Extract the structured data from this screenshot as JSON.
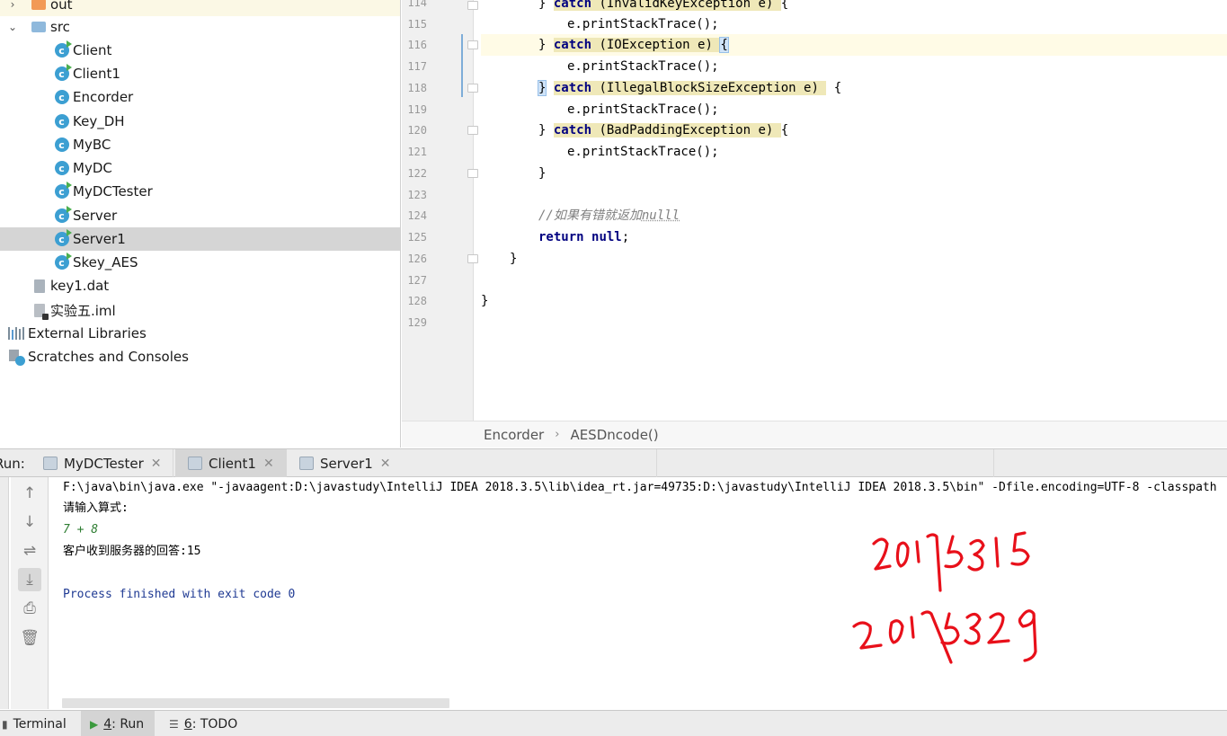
{
  "project_tree": {
    "items": [
      {
        "label": "out",
        "kind": "folder-out"
      },
      {
        "label": "src",
        "kind": "folder-src"
      },
      {
        "label": "Client",
        "kind": "class-run"
      },
      {
        "label": "Client1",
        "kind": "class-run"
      },
      {
        "label": "Encorder",
        "kind": "class"
      },
      {
        "label": "Key_DH",
        "kind": "class"
      },
      {
        "label": "MyBC",
        "kind": "class"
      },
      {
        "label": "MyDC",
        "kind": "class"
      },
      {
        "label": "MyDCTester",
        "kind": "class-run"
      },
      {
        "label": "Server",
        "kind": "class-run"
      },
      {
        "label": "Server1",
        "kind": "class-run"
      },
      {
        "label": "Skey_AES",
        "kind": "class-run"
      },
      {
        "label": "key1.dat",
        "kind": "unknown-file"
      },
      {
        "label": "实验五.iml",
        "kind": "iml-file"
      },
      {
        "label": "External Libraries",
        "kind": "libraries"
      },
      {
        "label": "Scratches and Consoles",
        "kind": "scratches"
      }
    ]
  },
  "editor": {
    "line_numbers": [
      "114",
      "115",
      "116",
      "117",
      "118",
      "119",
      "120",
      "121",
      "122",
      "123",
      "124",
      "125",
      "126",
      "127",
      "128",
      "129"
    ],
    "lines": {
      "l114": {
        "pre": "} ",
        "kw": "catch",
        "hl": " (InvalidKeyException e) ",
        "post": "{"
      },
      "l115": "e.printStackTrace();",
      "l116": {
        "pre": "} ",
        "kw": "catch",
        "hl": " (IOException e) ",
        "post": "{"
      },
      "l117": "e.printStackTrace();",
      "l118": {
        "pre": "}",
        "kw": "catch",
        "hl": " (IllegalBlockSizeException e) ",
        "post": "{"
      },
      "l119": "e.printStackTrace();",
      "l120": {
        "pre": "} ",
        "kw": "catch",
        "hl": " (BadPaddingException e) ",
        "post": "{"
      },
      "l121": "e.printStackTrace();",
      "l122": "}",
      "l124": {
        "comment": "//如果有错就返加",
        "comment_tail": "nulll"
      },
      "l125": {
        "kw1": "return",
        "kw2": "null",
        "post": ";"
      },
      "l126": "}",
      "l128": "}"
    },
    "breadcrumb": [
      "Encorder",
      "AESDncode()"
    ]
  },
  "run_window": {
    "title": "Run:",
    "tabs": [
      "MyDCTester",
      "Client1",
      "Server1"
    ],
    "active_tab": "Client1",
    "console": {
      "command": "F:\\java\\bin\\java.exe \"-javaagent:D:\\javastudy\\IntelliJ IDEA 2018.3.5\\lib\\idea_rt.jar=49735:D:\\javastudy\\IntelliJ IDEA 2018.3.5\\bin\" -Dfile.encoding=UTF-8 -classpath",
      "prompt": "请输入算式:",
      "input": "7 + 8",
      "response": "客户收到服务器的回答:15",
      "exit": "Process finished with exit code 0"
    },
    "toolbar_icons": [
      "up-arrow-icon",
      "down-arrow-icon",
      "soft-wrap-icon",
      "scroll-to-end-icon",
      "print-icon",
      "trash-icon"
    ]
  },
  "handwriting": {
    "line1": "20175315",
    "line2": "20175329",
    "color": "#e8101a"
  },
  "statusbar": {
    "terminal": "Terminal",
    "run_num": "4",
    "run_label": ": Run",
    "todo_num": "6",
    "todo_label": ": TODO"
  },
  "colors": {
    "keyword": "#000080",
    "class_icon": "#3c9fd2",
    "selection": "#d5d5d5",
    "console_input": "#2e7d32",
    "exit_text": "#1f3a93"
  }
}
